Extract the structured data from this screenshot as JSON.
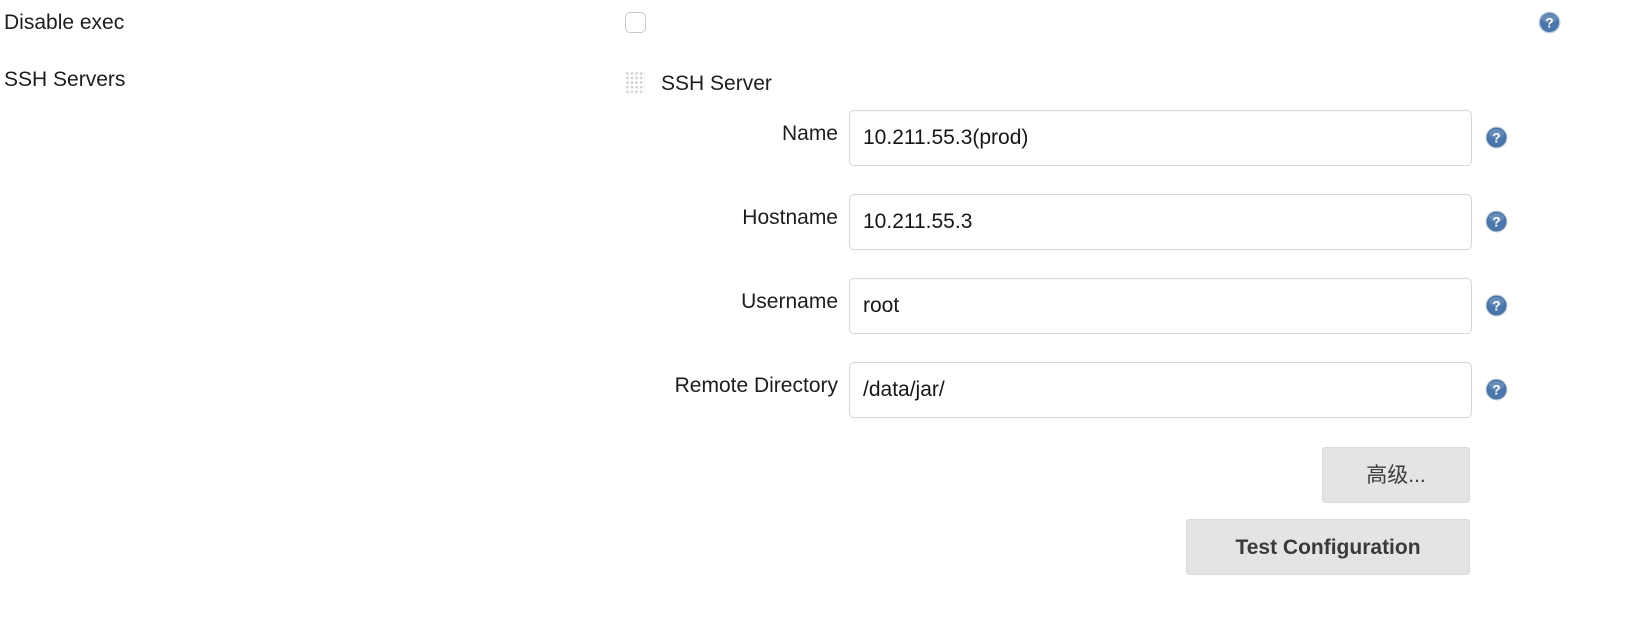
{
  "form": {
    "rows": [
      {
        "label": "Disable exec"
      },
      {
        "label": "SSH Servers"
      }
    ],
    "disable_exec": {
      "label": "Disable exec",
      "checked": false,
      "help_icon": "help-icon"
    },
    "ssh_servers": {
      "label": "SSH Servers",
      "section_title": "SSH Server",
      "drag_handle_icon": "drag-handle-icon",
      "fields": [
        {
          "label": "Name",
          "value": "10.211.55.3(prod)",
          "placeholder": "",
          "help_icon": "help-icon"
        },
        {
          "label": "Hostname",
          "value": "10.211.55.3",
          "placeholder": "",
          "help_icon": "help-icon"
        },
        {
          "label": "Username",
          "value": "root",
          "placeholder": "",
          "help_icon": "help-icon"
        },
        {
          "label": "Remote Directory",
          "value": "/data/jar/",
          "placeholder": "",
          "help_icon": "help-icon"
        }
      ],
      "buttons": {
        "advanced": "高级...",
        "test_configuration": "Test Configuration"
      }
    }
  },
  "colors": {
    "help_icon_blue": "#3b6ea8",
    "help_icon_ring": "#9db4ce",
    "button_face": "#e4e4e4",
    "input_border": "#d6d7d9",
    "text": "#1d1d1d"
  }
}
